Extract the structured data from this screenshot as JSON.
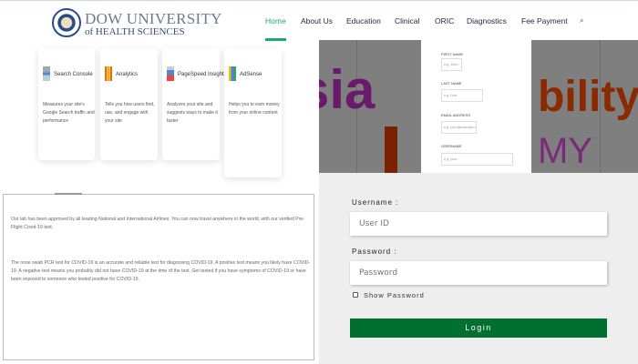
{
  "header": {
    "logo_line1": "DOW UNIVERSITY",
    "logo_line2": "of HEALTH SCIENCES",
    "nav": [
      "Home",
      "About Us",
      "Education",
      "Clinical",
      "ORIC",
      "Diagnostics",
      "Fee Payment"
    ],
    "active": "Home",
    "accent": "#1aaa6a"
  },
  "cards": [
    {
      "title": "Search Console",
      "desc": "Measures your site's Google Search traffic and performance"
    },
    {
      "title": "Analytics",
      "desc": "Tells you how users find, use, and engage with your site"
    },
    {
      "title": "PageSpeed Insights",
      "desc": "Analyzes your site and suggests ways to make it faster"
    },
    {
      "title": "AdSense",
      "desc": "Helps you to earn money from your online content"
    }
  ],
  "info": {
    "p1": "Our lab has been approved by all leading National and International Airlines. You can now travel anywhere in the world, with our verified Pre-Flight Covid-19 test.",
    "p2": "The nose swab PCR test for COVID-19 is an accurate and reliable test for diagnosing COVID-19. A positive test means you likely have COVID-19. A negative test means you probably did not have COVID-19 at the time of the test. Get tested if you have symptoms of COVID-19 or have been exposed to someone who tested positive for COVID-19."
  },
  "signup": {
    "fields": [
      {
        "label": "FIRST NAME",
        "placeholder": "e.g. John"
      },
      {
        "label": "LAST NAME",
        "placeholder": "e.g. Doe"
      },
      {
        "label": "EMAIL ADDRESS",
        "placeholder": "e.g. john@example.com"
      },
      {
        "label": "USERNAME",
        "placeholder": "e.g. jdoe"
      }
    ],
    "bg_text_left": "sia",
    "bg_text_right": "bility",
    "bg_text_right2": "MY"
  },
  "login": {
    "username_label": "Username :",
    "username_placeholder": "User ID",
    "password_label": "Password :",
    "password_placeholder": "Password",
    "show_password": "Show Password",
    "login_button": "Login",
    "button_color": "#006f2f"
  }
}
